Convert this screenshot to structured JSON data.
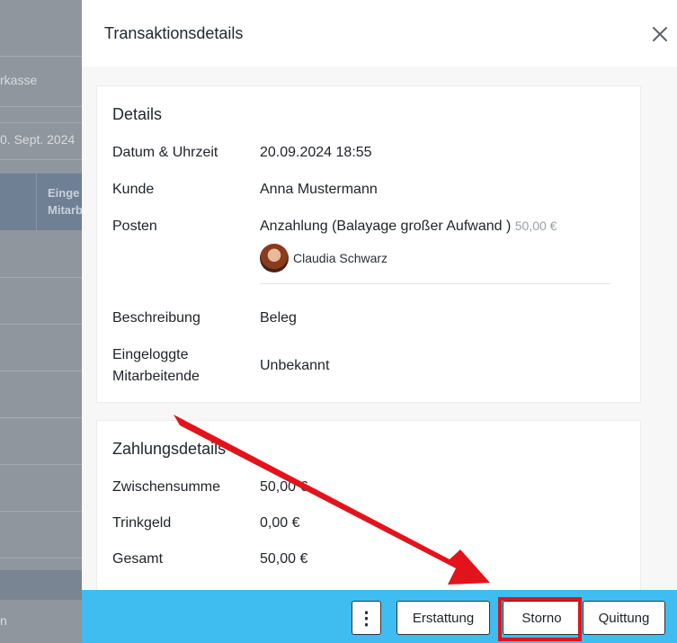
{
  "background": {
    "register_label": "rkasse",
    "date_label": "0. Sept. 2024",
    "column_header_line1": "Einge",
    "column_header_line2": "Mitarb",
    "footer_text": "n"
  },
  "drawer": {
    "title": "Transaktionsdetails",
    "details": {
      "title": "Details",
      "datetime_label": "Datum & Uhrzeit",
      "datetime_value": "20.09.2024 18:55",
      "customer_label": "Kunde",
      "customer_value": "Anna Mustermann",
      "items_label": "Posten",
      "item_name": "Anzahlung (Balayage großer Aufwand )",
      "item_price": "50,00 €",
      "item_staff": "Claudia Schwarz",
      "description_label": "Beschreibung",
      "description_value": "Beleg",
      "logged_in_label_line1": "Eingeloggte",
      "logged_in_label_line2": "Mitarbeitende",
      "logged_in_value": "Unbekannt"
    },
    "payment": {
      "title": "Zahlungsdetails",
      "subtotal_label": "Zwischensumme",
      "subtotal_value": "50,00 €",
      "tip_label": "Trinkgeld",
      "tip_value": "0,00 €",
      "total_label": "Gesamt",
      "total_value": "50,00 €"
    },
    "footer": {
      "more_label": "⋮",
      "refund_label": "Erstattung",
      "cancel_label": "Storno",
      "receipt_label": "Quittung"
    }
  },
  "colors": {
    "footer_bg": "#3fbcf0",
    "highlight": "#e3131b",
    "arrow": "#e3131b"
  },
  "icons": [
    "close-icon",
    "more-vertical-icon",
    "avatar",
    "annotation-arrow"
  ]
}
